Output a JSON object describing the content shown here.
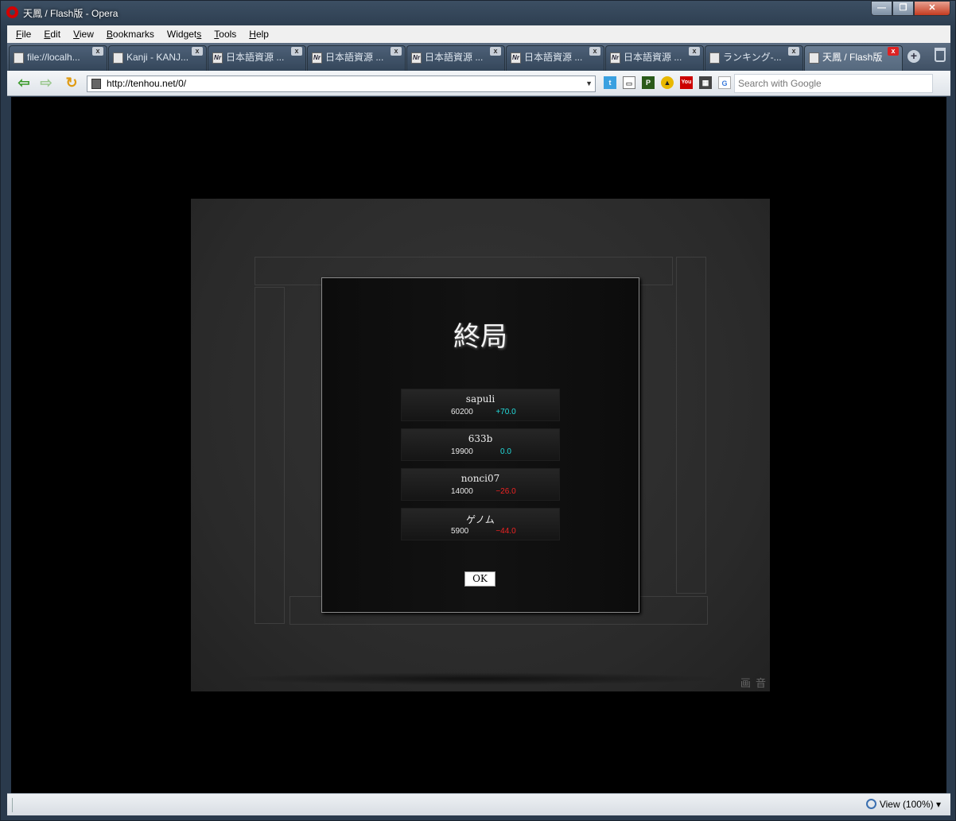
{
  "window": {
    "title": "天鳳 / Flash版 - Opera"
  },
  "menu": [
    {
      "pre": "",
      "u": "F",
      "post": "ile"
    },
    {
      "pre": "",
      "u": "E",
      "post": "dit"
    },
    {
      "pre": "",
      "u": "V",
      "post": "iew"
    },
    {
      "pre": "",
      "u": "B",
      "post": "ookmarks"
    },
    {
      "pre": "Widget",
      "u": "s",
      "post": ""
    },
    {
      "pre": "",
      "u": "T",
      "post": "ools"
    },
    {
      "pre": "",
      "u": "H",
      "post": "elp"
    }
  ],
  "tabs": [
    {
      "label": "file://localh...",
      "icon": "page-icon",
      "active": false
    },
    {
      "label": "Kanji - KANJ...",
      "icon": "page-icon",
      "active": false
    },
    {
      "label": "日本語資源 ...",
      "icon": "nr-icon",
      "active": false
    },
    {
      "label": "日本語資源 ...",
      "icon": "nr-icon",
      "active": false
    },
    {
      "label": "日本語資源 ...",
      "icon": "nr-icon",
      "active": false
    },
    {
      "label": "日本語資源 ...",
      "icon": "nr-icon",
      "active": false
    },
    {
      "label": "日本語資源 ...",
      "icon": "nr-icon",
      "active": false
    },
    {
      "label": "ランキング-...",
      "icon": "image-icon",
      "active": false
    },
    {
      "label": "天鳳 / Flash版",
      "icon": "tenhou-icon",
      "active": true
    }
  ],
  "tab_icon_text": {
    "nr": "Nr",
    "close": "x",
    "add": "+"
  },
  "address": {
    "url": "http://tenhou.net/0/",
    "dropdown": "▼"
  },
  "search": {
    "placeholder": "Search with Google"
  },
  "toolbar_icons": [
    {
      "name": "twitter-icon",
      "glyph": "t",
      "color": "#3aa0e0"
    },
    {
      "name": "tv-icon",
      "glyph": "▭",
      "color": "#555"
    },
    {
      "name": "p-icon",
      "glyph": "P",
      "color": "#2a5a1a"
    },
    {
      "name": "arrow-up-icon",
      "glyph": "▲",
      "color": "#222"
    },
    {
      "name": "youtube-icon",
      "glyph": "You",
      "color": "#c00"
    },
    {
      "name": "photo-icon",
      "glyph": "▦",
      "color": "#444"
    },
    {
      "name": "google-icon",
      "glyph": "G",
      "color": "#3a7adb"
    }
  ],
  "nav": {
    "back": "⇦",
    "forward": "⇨",
    "reload": "↻"
  },
  "game": {
    "title": "終局",
    "players": [
      {
        "name": "sapuli",
        "score": "60200",
        "delta": "+70.0",
        "color": "#22dddd"
      },
      {
        "name": "633b",
        "score": "19900",
        "delta": "0.0",
        "color": "#22dddd"
      },
      {
        "name": "nonci07",
        "score": "14000",
        "delta": "−26.0",
        "color": "#ee2222"
      },
      {
        "name": "ゲノム",
        "score": "5900",
        "delta": "−44.0",
        "color": "#ee2222"
      }
    ],
    "ok_label": "OK",
    "stamp": "画 音"
  },
  "status": {
    "zoom": "View (100%)",
    "zoom_arrow": "▾"
  },
  "window_buttons": {
    "min": "—",
    "max": "❐",
    "close": "✕"
  }
}
